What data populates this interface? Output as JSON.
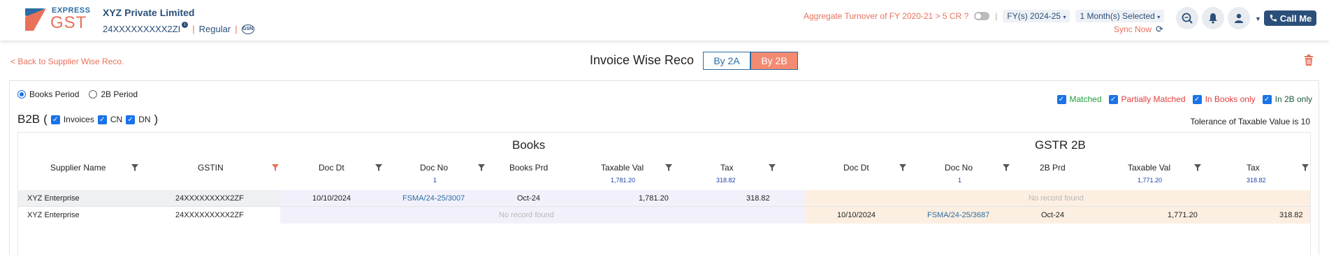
{
  "header": {
    "logo_top": "EXPRESS",
    "logo_main": "GST",
    "company_name": "XYZ Private Limited",
    "gstin": "24XXXXXXXXX2ZI",
    "registration_type": "Regular",
    "aggregate_question": "Aggregate Turnover of FY 2020-21 > 5 CR ?",
    "fy_selector": "FY(s) 2024-25",
    "month_selector": "1 Month(s) Selected",
    "sync_label": "Sync Now",
    "call_label": "Call Me",
    "gsn_badge": "GSN"
  },
  "subheader": {
    "back_link": "< Back to Supplier Wise Reco.",
    "title": "Invoice Wise Reco",
    "tab_2a": "By 2A",
    "tab_2b": "By 2B",
    "active_tab": "By 2B"
  },
  "period": {
    "options": [
      "Books Period",
      "2B Period"
    ],
    "selected": "Books Period"
  },
  "status_filters": [
    {
      "label": "Matched",
      "checked": true,
      "color": "#1e9e3c"
    },
    {
      "label": "Partially Matched",
      "checked": true,
      "color": "#e43b3b"
    },
    {
      "label": "In Books only",
      "checked": true,
      "color": "#e43b3b"
    },
    {
      "label": "In 2B only",
      "checked": true,
      "color": "#1f5a3c"
    }
  ],
  "section": {
    "title": "B2B",
    "open_paren": "(",
    "close_paren": ")",
    "doc_types": [
      {
        "label": "Invoices",
        "checked": true
      },
      {
        "label": "CN",
        "checked": true
      },
      {
        "label": "DN",
        "checked": true
      }
    ],
    "tolerance": "Tolerance of Taxable Value is 10"
  },
  "table": {
    "group_books": "Books",
    "group_gstr": "GSTR 2B",
    "columns": {
      "supplier": "Supplier Name",
      "gstin": "GSTIN",
      "books_doc_dt": "Doc Dt",
      "books_doc_no": "Doc No",
      "books_prd": "Books Prd",
      "books_taxable": "Taxable Val",
      "books_tax": "Tax",
      "gstr_doc_dt": "Doc Dt",
      "gstr_doc_no": "Doc No",
      "gstr_prd": "2B Prd",
      "gstr_taxable": "Taxable Val",
      "gstr_tax": "Tax"
    },
    "summary": {
      "books_doc_count": "1",
      "books_taxable": "1,781.20",
      "books_tax": "318.82",
      "gstr_doc_count": "1",
      "gstr_taxable": "1,771.20",
      "gstr_tax": "318.82"
    },
    "rows": [
      {
        "supplier": "XYZ Enterprise",
        "gstin": "24XXXXXXXXX2ZF",
        "books_doc_dt": "10/10/2024",
        "books_doc_no": "FSMA/24-25/3007",
        "books_prd": "Oct-24",
        "books_taxable": "1,781.20",
        "books_tax": "318.82",
        "gstr_no_record": "No record found"
      },
      {
        "supplier": "XYZ Enterprise",
        "gstin": "24XXXXXXXXX2ZF",
        "books_no_record": "No record found",
        "gstr_doc_dt": "10/10/2024",
        "gstr_doc_no": "FSMA/24-25/3687",
        "gstr_prd": "Oct-24",
        "gstr_taxable": "1,771.20",
        "gstr_tax": "318.82"
      }
    ]
  }
}
